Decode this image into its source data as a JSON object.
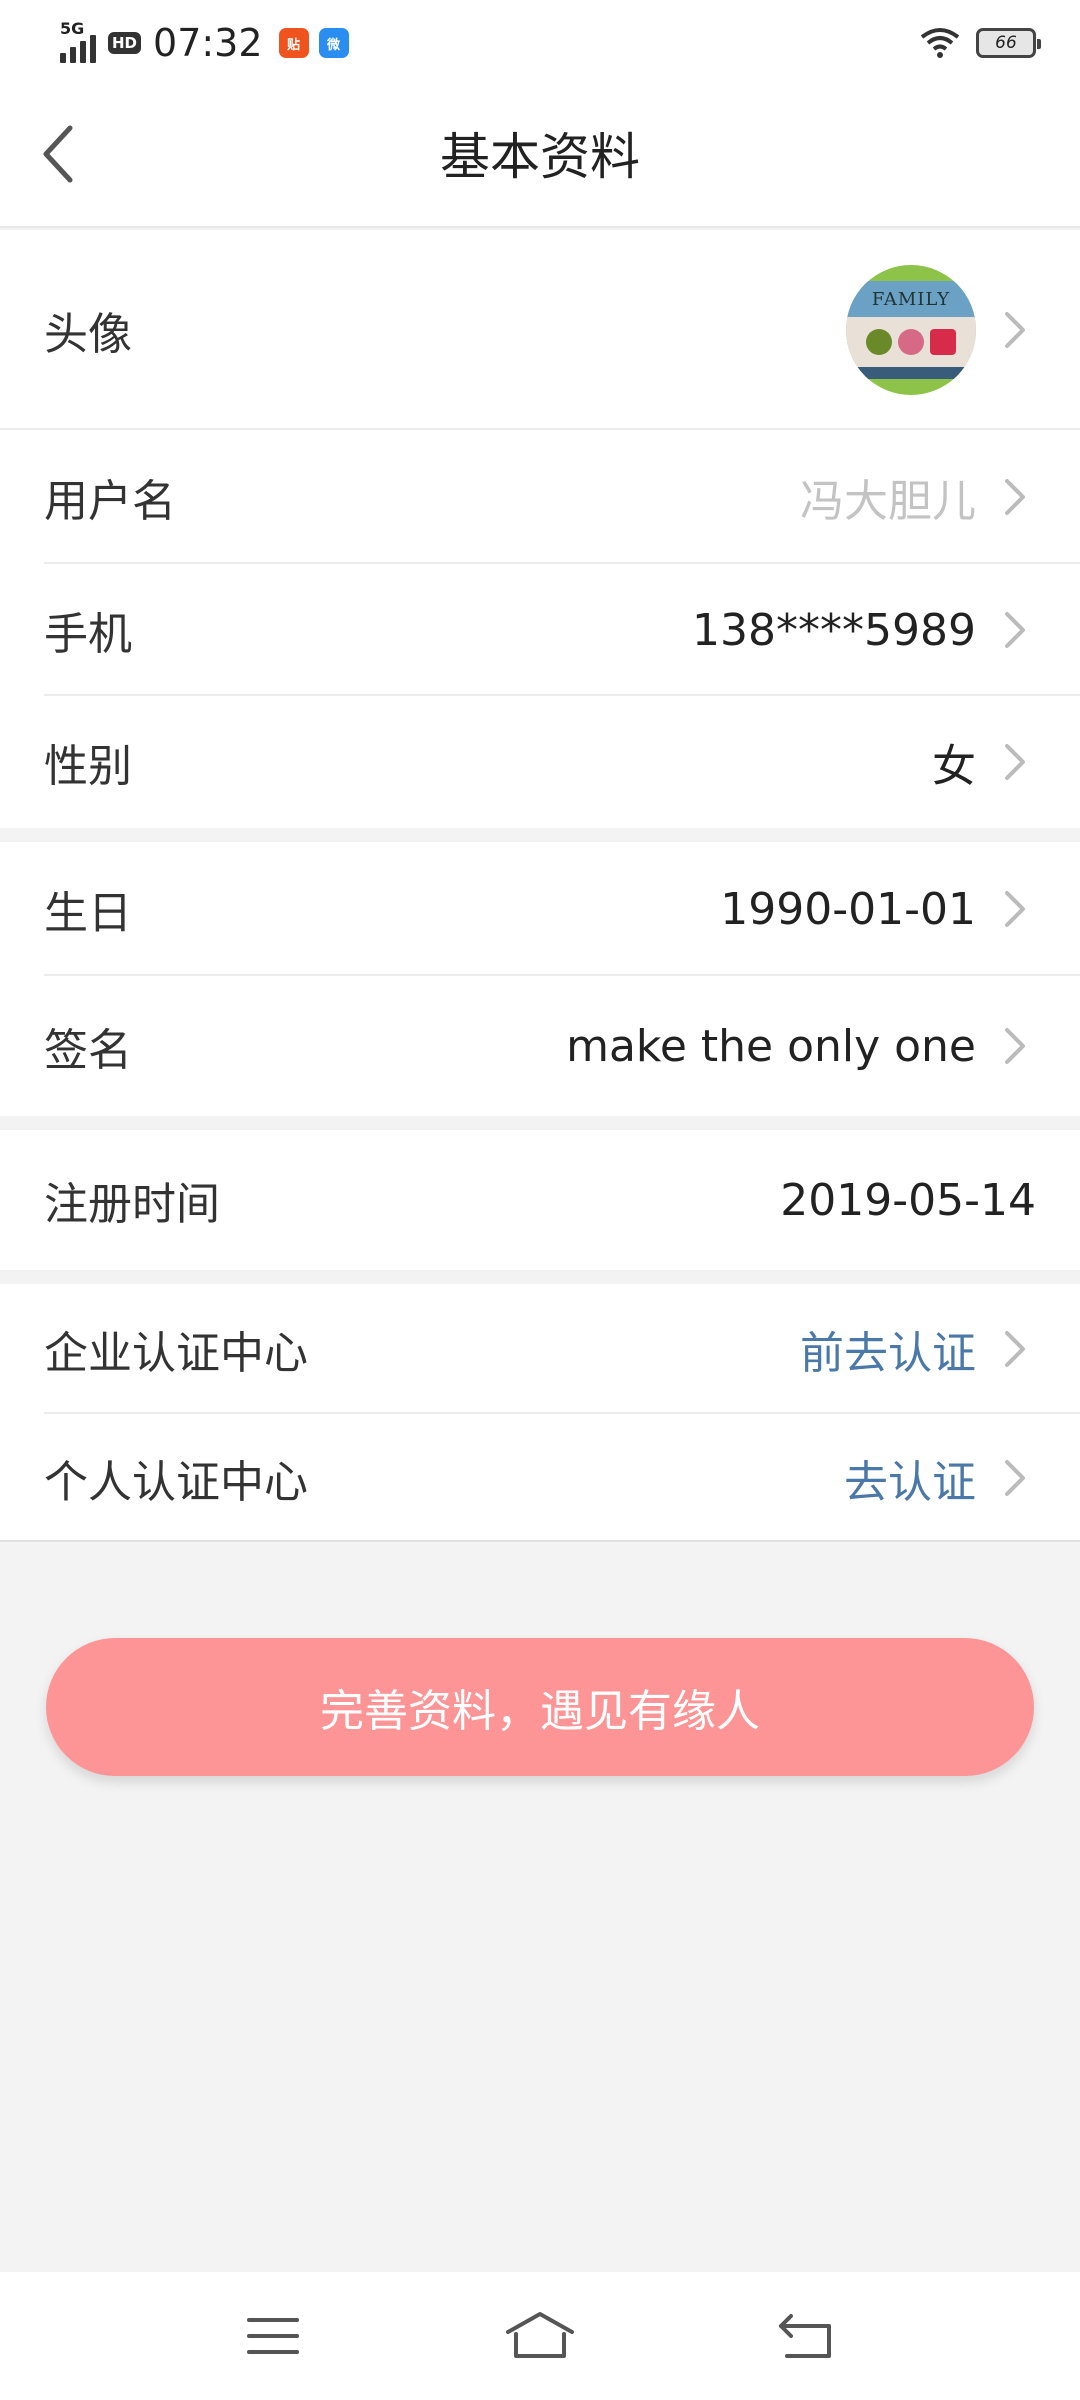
{
  "status_bar": {
    "network": "5G",
    "hd": "HD",
    "time": "07:32",
    "app1": "贴",
    "app2": "微",
    "battery": "66"
  },
  "header": {
    "title": "基本资料"
  },
  "profile": {
    "avatar_label": "头像",
    "avatar_text": "FAMILY",
    "username_label": "用户名",
    "username_value": "冯大胆儿",
    "phone_label": "手机",
    "phone_value": "138****5989",
    "gender_label": "性别",
    "gender_value": "女"
  },
  "details": {
    "birthday_label": "生日",
    "birthday_value": "1990-01-01",
    "signature_label": "签名",
    "signature_value": "make the only one"
  },
  "registration": {
    "label": "注册时间",
    "value": "2019-05-14"
  },
  "certification": {
    "enterprise_label": "企业认证中心",
    "enterprise_action": "前去认证",
    "personal_label": "个人认证中心",
    "personal_action": "去认证"
  },
  "cta": {
    "label": "完善资料，遇见有缘人"
  },
  "colors": {
    "cta": "#fd9495",
    "link": "#4a78a8",
    "placeholder": "#c3c3c3",
    "background": "#f3f3f3"
  },
  "icons": [
    "back-arrow-icon",
    "chevron-right-icon",
    "menu-icon",
    "home-icon",
    "back-nav-icon",
    "wifi-icon",
    "battery-icon",
    "signal-icon"
  ]
}
